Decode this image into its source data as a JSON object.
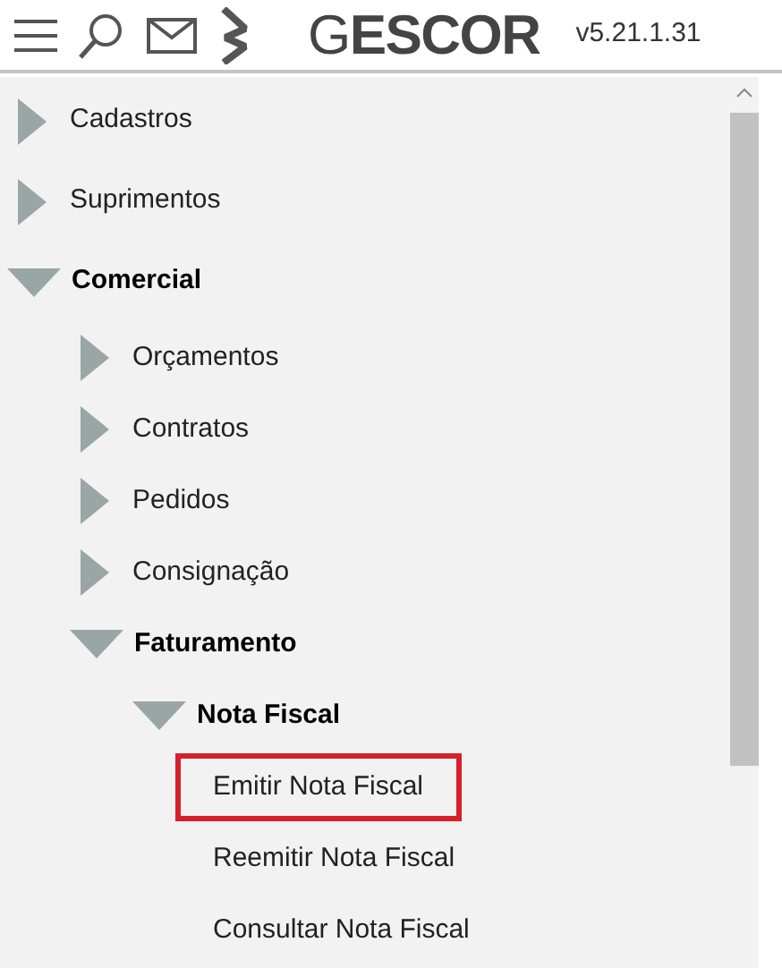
{
  "header": {
    "logo": "G**ESCOR**",
    "version": "v5.21.1.31"
  },
  "menu": [
    {
      "label": "Cadastros",
      "expanded": false
    },
    {
      "label": "Suprimentos",
      "expanded": false
    },
    {
      "label": "Comercial",
      "expanded": true,
      "children": [
        {
          "label": "Orçamentos",
          "expanded": false
        },
        {
          "label": "Contratos",
          "expanded": false
        },
        {
          "label": "Pedidos",
          "expanded": false
        },
        {
          "label": "Consignação",
          "expanded": false
        },
        {
          "label": "Faturamento",
          "expanded": true,
          "children": [
            {
              "label": "Nota Fiscal",
              "expanded": true,
              "children": [
                {
                  "label": "Emitir Nota Fiscal",
                  "kind": "leaf",
                  "selected": true
                },
                {
                  "label": "Reemitir Nota Fiscal",
                  "kind": "leaf",
                  "selected": false
                },
                {
                  "label": "Consultar Nota Fiscal",
                  "kind": "leaf",
                  "selected": false
                }
              ]
            }
          ]
        }
      ]
    }
  ]
}
